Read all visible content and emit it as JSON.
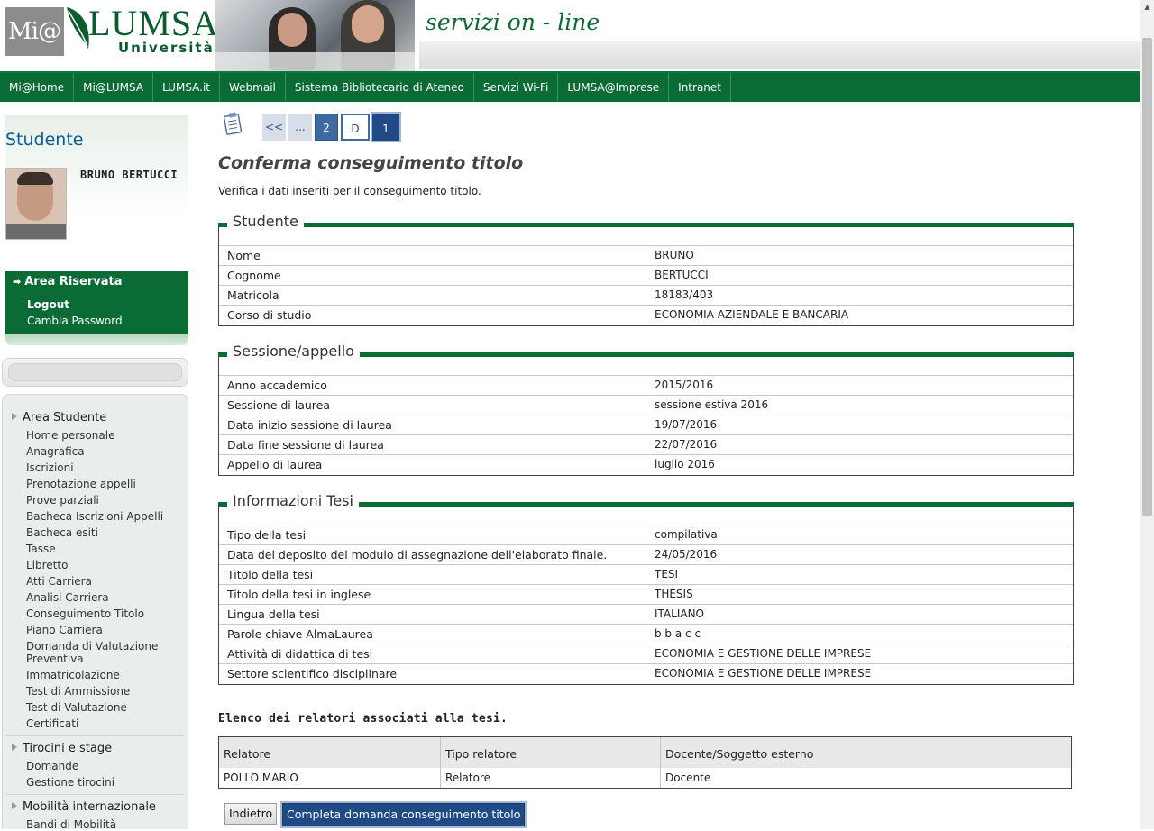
{
  "header": {
    "logo_mi": "Mi@",
    "logo_lumsa": "LUMSA",
    "logo_universita": "Università",
    "tagline": "servizi on - line"
  },
  "nav": {
    "items": [
      "Mi@Home",
      "Mi@LUMSA",
      "LUMSA.it",
      "Webmail",
      "Sistema Bibliotecario di Ateneo",
      "Servizi Wi-Fi",
      "LUMSA@Imprese",
      "Intranet"
    ]
  },
  "sidebar": {
    "title": "Studente",
    "student_name": "BRUNO BERTUCCI",
    "reserved": {
      "title": "Area Riservata",
      "logout": "Logout",
      "change_password": "Cambia Password"
    },
    "groups": [
      {
        "title": "Area Studente",
        "items": [
          "Home personale",
          "Anagrafica",
          "Iscrizioni",
          "Prenotazione appelli",
          "Prove parziali",
          "Bacheca Iscrizioni Appelli",
          "Bacheca esiti",
          "Tasse",
          "Libretto",
          "Atti Carriera",
          "Analisi Carriera",
          "Conseguimento Titolo",
          "Piano Carriera",
          "Domanda di Valutazione Preventiva",
          "Immatricolazione",
          "Test di Ammissione",
          "Test di Valutazione",
          "Certificati"
        ]
      },
      {
        "title": "Tirocini e stage",
        "items": [
          "Domande",
          "Gestione tirocini"
        ]
      },
      {
        "title": "Mobilità internazionale",
        "items": [
          "Bandi di Mobilità"
        ]
      }
    ]
  },
  "pager": {
    "back": "<<",
    "dots": "...",
    "step_2": "2",
    "step_d": "D",
    "step_1": "1"
  },
  "main": {
    "title": "Conferma conseguimento titolo",
    "description": "Verifica i dati inseriti per il conseguimento titolo.",
    "sections": [
      {
        "legend": "Studente",
        "rows": [
          {
            "label": "Nome",
            "value": "BRUNO"
          },
          {
            "label": "Cognome",
            "value": "BERTUCCI"
          },
          {
            "label": "Matricola",
            "value": "18183/403"
          },
          {
            "label": "Corso di studio",
            "value": "ECONOMIA AZIENDALE E BANCARIA"
          }
        ]
      },
      {
        "legend": "Sessione/appello",
        "rows": [
          {
            "label": "Anno accademico",
            "value": "2015/2016"
          },
          {
            "label": "Sessione di laurea",
            "value": "sessione estiva 2016"
          },
          {
            "label": "Data inizio sessione di laurea",
            "value": "19/07/2016"
          },
          {
            "label": "Data fine sessione di laurea",
            "value": "22/07/2016"
          },
          {
            "label": "Appello di laurea",
            "value": "luglio 2016"
          }
        ]
      },
      {
        "legend": "Informazioni Tesi",
        "rows": [
          {
            "label": "Tipo della tesi",
            "value": "compilativa"
          },
          {
            "label": "Data del deposito del modulo di assegnazione dell'elaborato finale.",
            "value": "24/05/2016"
          },
          {
            "label": "Titolo della tesi",
            "value": "TESI"
          },
          {
            "label": "Titolo della tesi in inglese",
            "value": "THESIS"
          },
          {
            "label": "Lingua della tesi",
            "value": "ITALIANO"
          },
          {
            "label": "Parole chiave AlmaLaurea",
            "value": "b b a c c"
          },
          {
            "label": "Attività di didattica di tesi",
            "value": "ECONOMIA E GESTIONE DELLE IMPRESE"
          },
          {
            "label": "Settore scientifico disciplinare",
            "value": "ECONOMIA E GESTIONE DELLE IMPRESE"
          }
        ]
      }
    ],
    "relatori": {
      "title": "Elenco dei relatori associati alla tesi.",
      "headers": [
        "Relatore",
        "Tipo relatore",
        "Docente/Soggetto esterno"
      ],
      "rows": [
        [
          "POLLO MARIO",
          "Relatore",
          "Docente"
        ]
      ]
    },
    "buttons": {
      "back": "Indietro",
      "complete": "Completa domanda conseguimento titolo"
    }
  },
  "colors": {
    "brand_green": "#0a6b35",
    "accent_blue": "#1f4a85",
    "title_blue": "#0a5c96"
  }
}
